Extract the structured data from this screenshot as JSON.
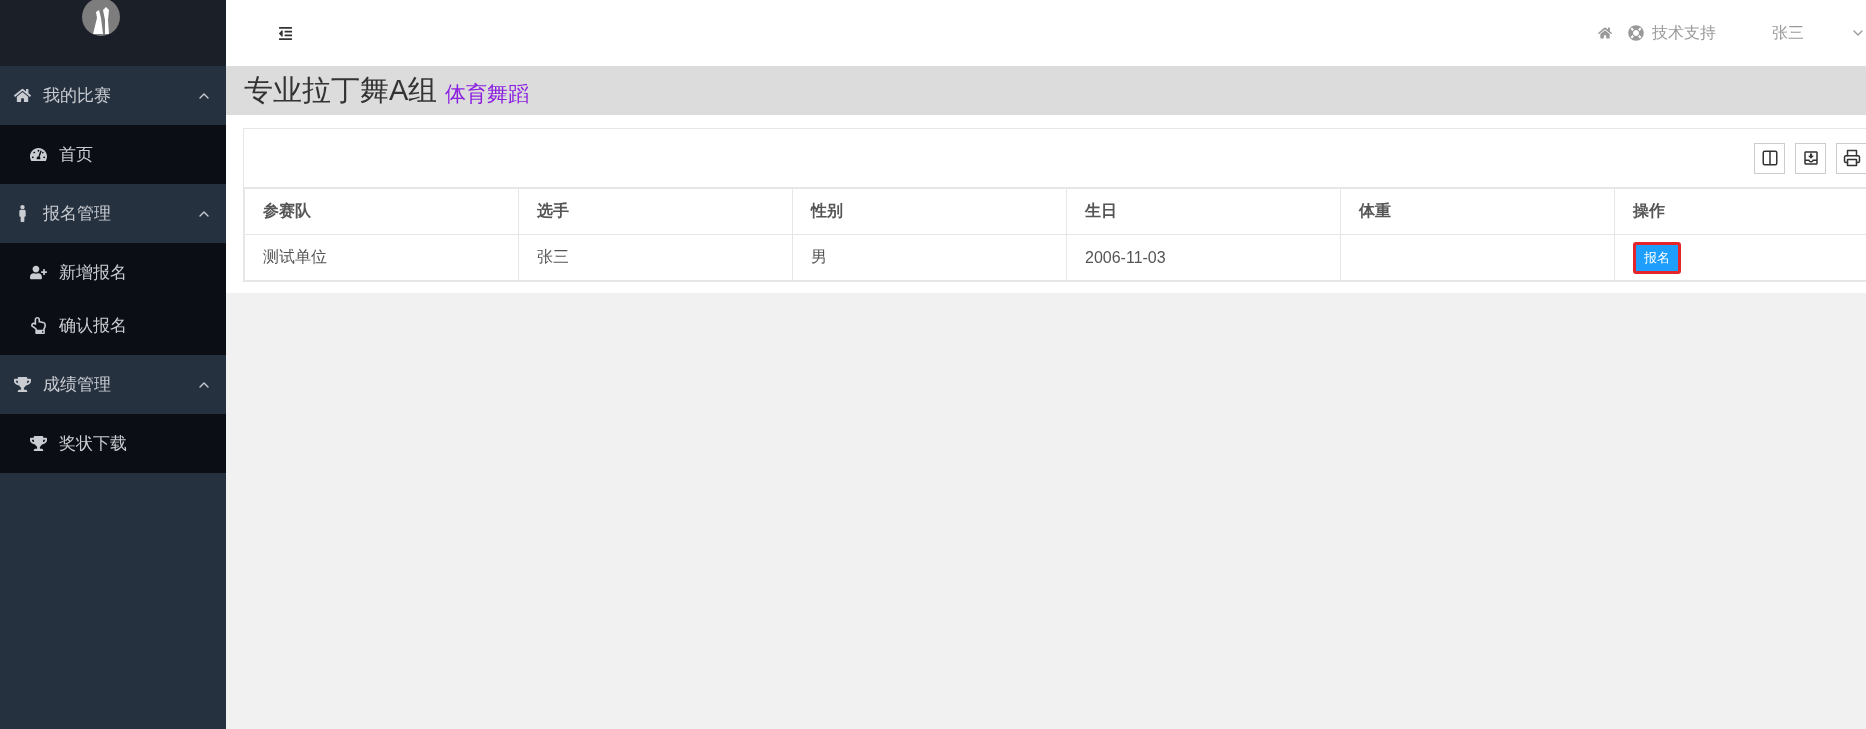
{
  "sidebar": {
    "groups": [
      {
        "label": "我的比赛",
        "kind": "home",
        "expanded": true,
        "items": [
          {
            "label": "首页",
            "kind": "dashboard"
          }
        ]
      },
      {
        "label": "报名管理",
        "kind": "person",
        "expanded": true,
        "items": [
          {
            "label": "新增报名",
            "kind": "user-plus"
          },
          {
            "label": "确认报名",
            "kind": "hand"
          }
        ]
      },
      {
        "label": "成绩管理",
        "kind": "trophy",
        "expanded": true,
        "items": [
          {
            "label": "奖状下载",
            "kind": "trophy"
          }
        ]
      }
    ]
  },
  "topbar": {
    "support": "技术支持",
    "user": "张三"
  },
  "page": {
    "title": "专业拉丁舞A组",
    "subtitle": "体育舞蹈"
  },
  "table": {
    "columns": [
      "参赛队",
      "选手",
      "性别",
      "生日",
      "体重",
      "操作"
    ],
    "rows": [
      {
        "cells": [
          "测试单位",
          "张三",
          "男",
          "2006-11-03",
          ""
        ],
        "action": "报名"
      }
    ]
  }
}
